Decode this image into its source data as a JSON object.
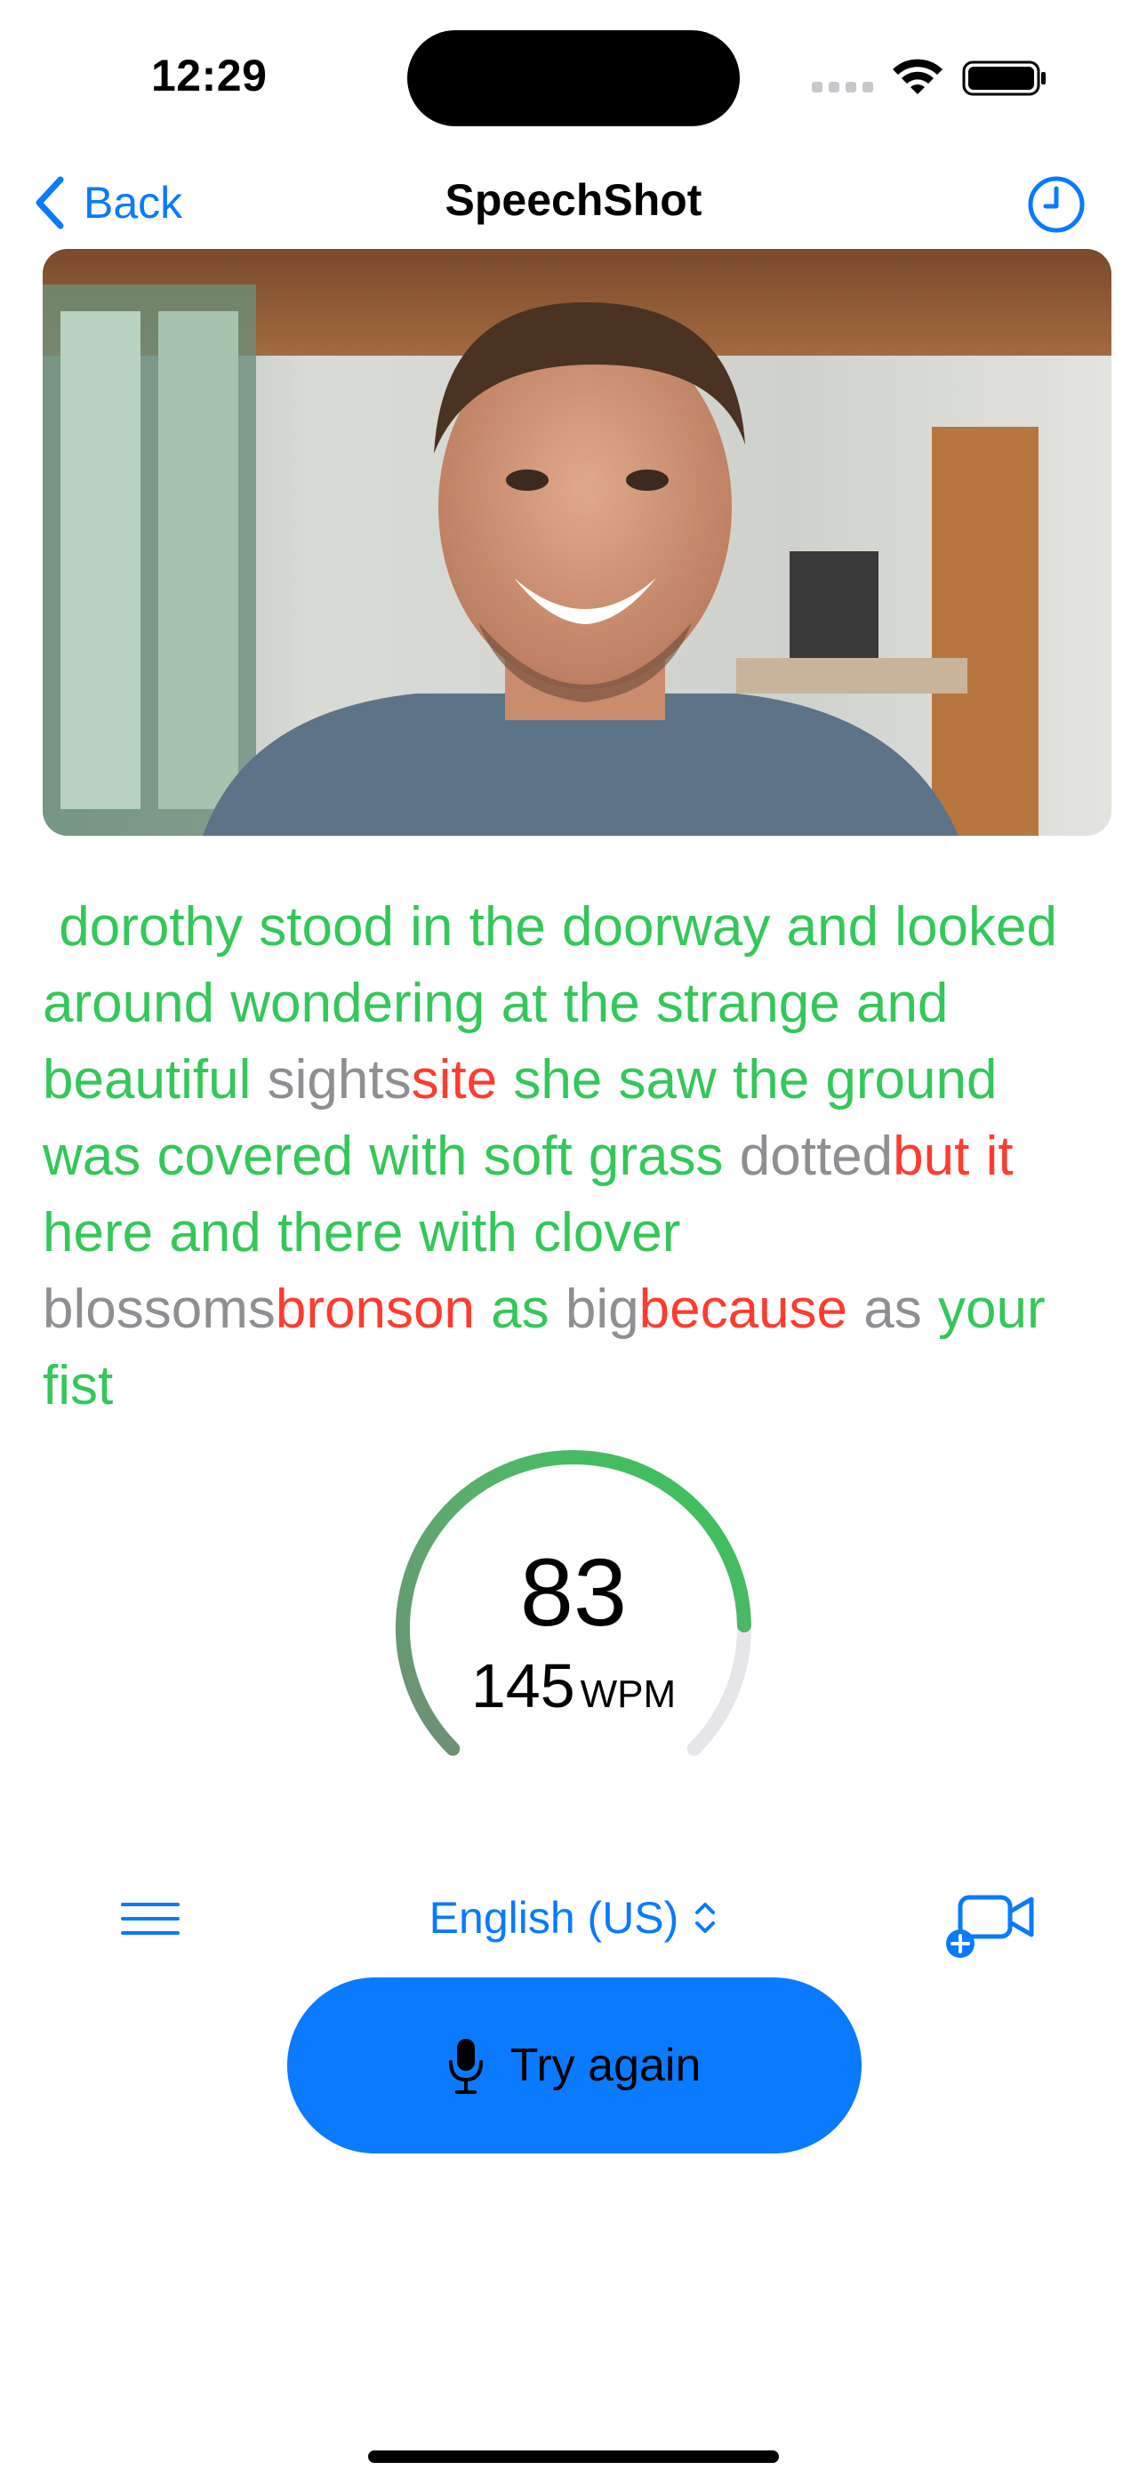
{
  "status_bar": {
    "time": "12:29"
  },
  "nav": {
    "back_label": "Back",
    "title": "SpeechShot",
    "history_icon": "clock-icon"
  },
  "transcript": [
    {
      "t": " dorothy stood in the doorway and looked around wondering at the strange and beautiful ",
      "s": "ok"
    },
    {
      "t": "sights",
      "s": "miss"
    },
    {
      "t": "site",
      "s": "wrong"
    },
    {
      "t": " she saw the ground was covered with soft grass ",
      "s": "ok"
    },
    {
      "t": "dotted",
      "s": "miss"
    },
    {
      "t": "but it",
      "s": "wrong"
    },
    {
      "t": " here and there with clover ",
      "s": "ok"
    },
    {
      "t": "blossoms",
      "s": "miss"
    },
    {
      "t": "bronson",
      "s": "wrong"
    },
    {
      "t": " as ",
      "s": "ok"
    },
    {
      "t": "big",
      "s": "miss"
    },
    {
      "t": "because",
      "s": "wrong"
    },
    {
      "t": " as ",
      "s": "miss"
    },
    {
      "t": "your fist",
      "s": "ok"
    }
  ],
  "results": {
    "score": "83",
    "score_fraction": 0.83,
    "wpm": "145",
    "wpm_unit": "WPM"
  },
  "controls": {
    "language": "English (US)",
    "menu_icon": "hamburger-icon",
    "video_icon": "video-add-icon",
    "try_again_label": "Try again",
    "mic_icon": "microphone-icon"
  },
  "colors": {
    "accent": "#0a7aff",
    "correct": "#34c759",
    "missed": "#8e8e93",
    "wrong": "#ff3b30",
    "gauge_track": "#e5e5ea"
  }
}
